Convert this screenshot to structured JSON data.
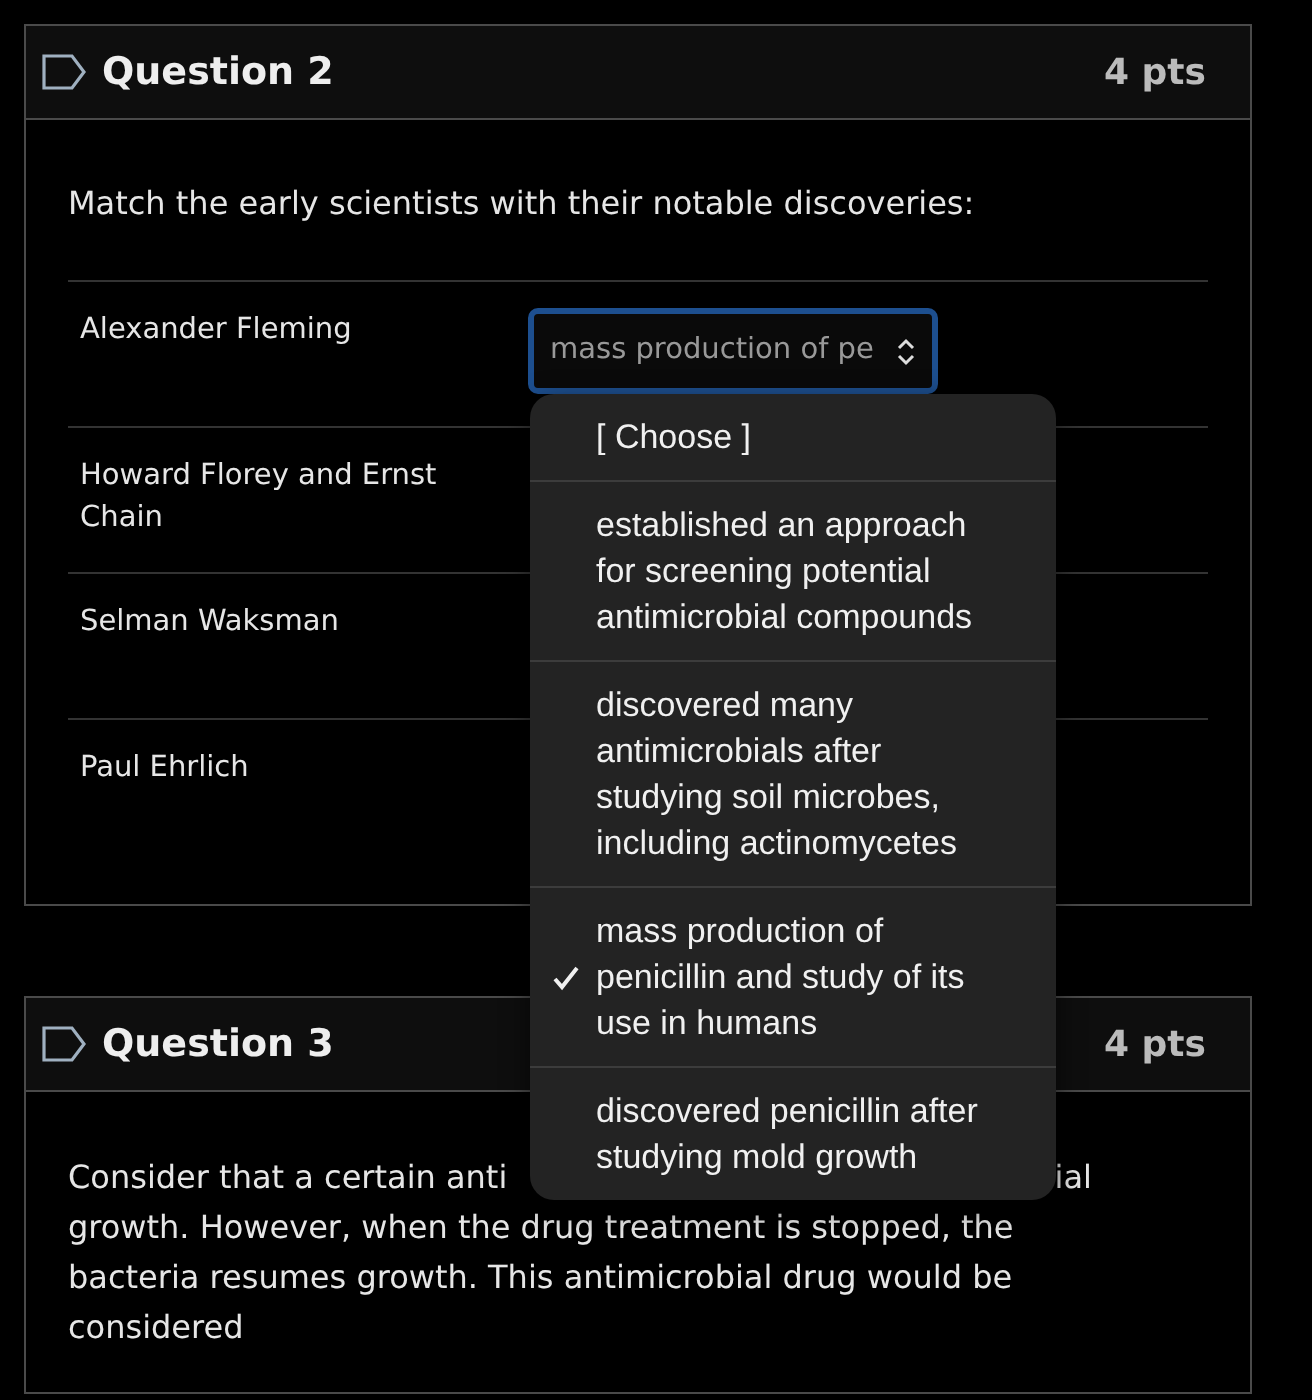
{
  "questions": [
    {
      "title": "Question 2",
      "points": "4 pts",
      "prompt": "Match the early scientists with their notable discoveries:",
      "rows": [
        {
          "label": "Alexander Fleming",
          "value": "mass production of pe"
        },
        {
          "label": "Howard Florey and Ernst Chain"
        },
        {
          "label": "Selman Waksman"
        },
        {
          "label": "Paul Ehrlich"
        }
      ]
    },
    {
      "title": "Question 3",
      "points": "4 pts",
      "prompt_line_pieces": [
        "Consider that a certain anti",
        "ial"
      ],
      "prompt_rest": "growth. However, when the drug treatment is stopped, the bacteria resumes growth. This antimicrobial drug would be considered"
    }
  ],
  "dropdown": {
    "options": [
      {
        "text": "[ Choose ]",
        "selected": false
      },
      {
        "text": "established an approach for screening potential antimicrobial compounds",
        "selected": false
      },
      {
        "text": "discovered many antimicrobials after studying soil microbes, including actinomycetes",
        "selected": false
      },
      {
        "text": "mass production of penicillin and study of its use in humans",
        "selected": true
      },
      {
        "text": "discovered penicillin after studying mold growth",
        "selected": false
      }
    ]
  }
}
